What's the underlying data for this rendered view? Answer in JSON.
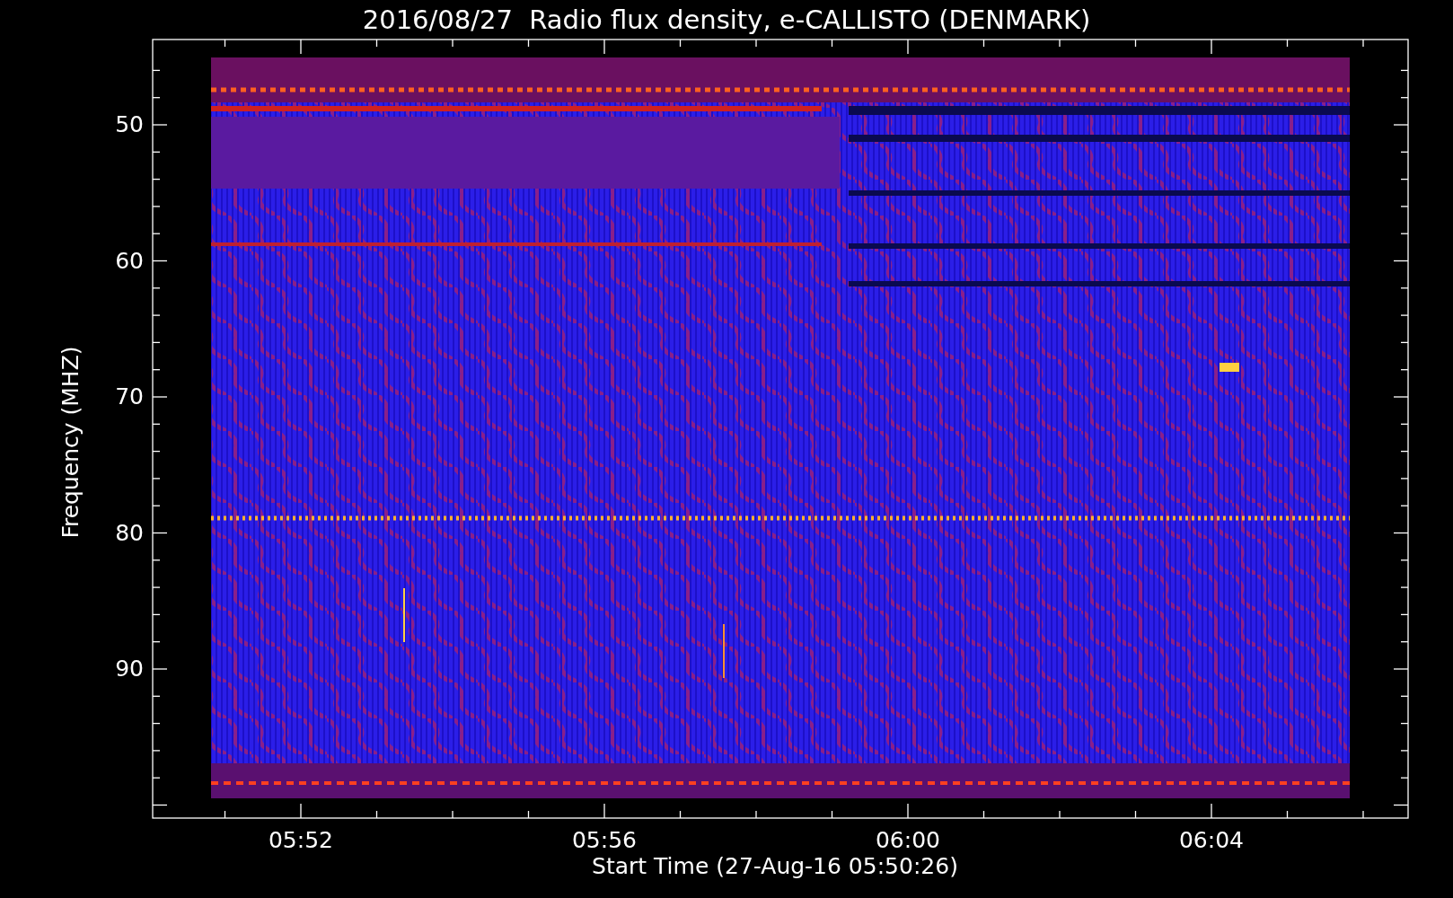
{
  "title": "2016/08/27  Radio flux density, e-CALLISTO (DENMARK)",
  "y_axis": {
    "label": "Frequency (MHZ)",
    "ticks": [
      "50",
      "60",
      "70",
      "80",
      "90"
    ]
  },
  "x_axis": {
    "label": "Start Time (27-Aug-16 05:50:26)",
    "ticks": [
      "05:52",
      "05:56",
      "06:00",
      "06:04"
    ]
  }
}
